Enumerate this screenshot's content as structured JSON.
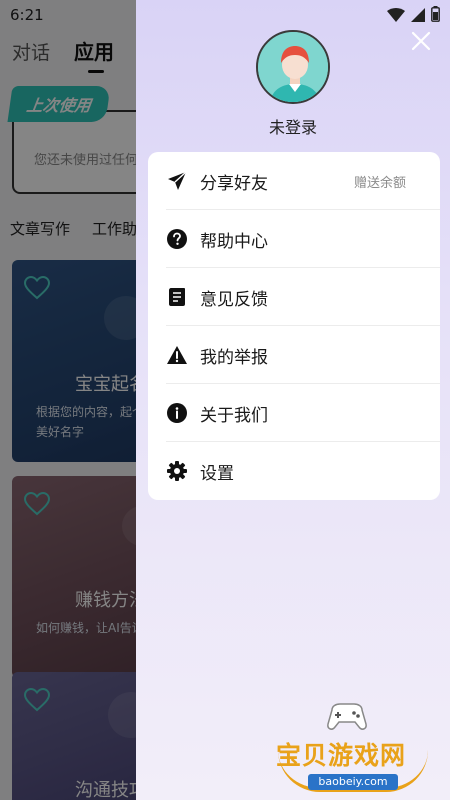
{
  "status": {
    "time": "6:21"
  },
  "background": {
    "tabs": [
      "对话",
      "应用"
    ],
    "active_tab": 1,
    "recent": {
      "badge": "上次使用",
      "text": "您还未使用过任何应用"
    },
    "categories": [
      "文章写作",
      "工作助手"
    ],
    "cards": [
      {
        "title": "宝宝起名",
        "desc": "根据您的内容，起个寓意美好名字"
      },
      {
        "title": "赚钱方法",
        "desc": "如何赚钱，让AI告诉你"
      },
      {
        "title": "沟通技巧",
        "desc": ""
      }
    ]
  },
  "drawer": {
    "login_label": "未登录",
    "menu": [
      {
        "label": "分享好友",
        "icon": "send-icon",
        "extra": "赠送余额"
      },
      {
        "label": "帮助中心",
        "icon": "help-icon",
        "extra": ""
      },
      {
        "label": "意见反馈",
        "icon": "feedback-icon",
        "extra": ""
      },
      {
        "label": "我的举报",
        "icon": "warning-icon",
        "extra": ""
      },
      {
        "label": "关于我们",
        "icon": "info-icon",
        "extra": ""
      },
      {
        "label": "设置",
        "icon": "gear-icon",
        "extra": ""
      }
    ]
  },
  "watermark": {
    "text": "宝贝游戏网",
    "url": "baobeiy.com"
  },
  "colors": {
    "accent": "#2fc3b8",
    "drawer_bg": "#e6e1f8",
    "watermark": "#e9a21a"
  }
}
